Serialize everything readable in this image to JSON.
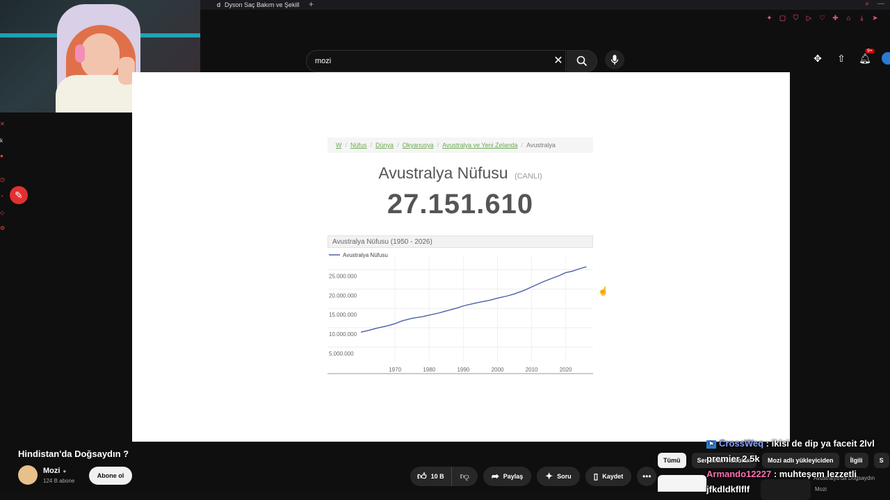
{
  "browser": {
    "tab_title": "Dyson Saç Bakım ve Şekill",
    "tab_favicon": "d",
    "new_tab_label": "+"
  },
  "search": {
    "query": "mozi"
  },
  "header": {
    "notif_count": "9+"
  },
  "page": {
    "breadcrumb": [
      "W",
      "Nüfus",
      "Dünya",
      "Okyanusya",
      "Avustralya ve Yeni Zelanda"
    ],
    "breadcrumb_current": "Avustralya",
    "title": "Avustralya Nüfusu",
    "live_label": "(CANLI)",
    "population": "27.151.610"
  },
  "chart_data": {
    "type": "line",
    "title": "Avustralya Nüfusu (1950 - 2026)",
    "legend": [
      "Avustralya Nüfusu"
    ],
    "legend_position": "top-left",
    "x_ticks": [
      "1970",
      "1980",
      "1990",
      "2000",
      "2010",
      "2020"
    ],
    "y_ticks": [
      "5.000.000",
      "10.000.000",
      "15.000.000",
      "20.000.000",
      "25.000.000"
    ],
    "xlim": [
      1960,
      2028
    ],
    "ylim": [
      3000000,
      28500000
    ],
    "grid": true,
    "series": [
      {
        "name": "Avustralya Nüfusu",
        "x": [
          1960,
          1962,
          1965,
          1968,
          1970,
          1972,
          1975,
          1978,
          1980,
          1983,
          1985,
          1988,
          1990,
          1993,
          1995,
          1998,
          2000,
          2003,
          2005,
          2008,
          2010,
          2013,
          2015,
          2018,
          2020,
          2022,
          2024,
          2026
        ],
        "y": [
          10300000,
          10700000,
          11400000,
          12000000,
          12500000,
          13200000,
          13900000,
          14300000,
          14700000,
          15300000,
          15800000,
          16500000,
          17100000,
          17700000,
          18100000,
          18600000,
          19100000,
          19700000,
          20200000,
          21200000,
          22000000,
          23200000,
          23900000,
          24900000,
          25700000,
          26100000,
          26700000,
          27200000
        ]
      }
    ],
    "line_color": "#4a5fa8"
  },
  "video": {
    "title": "Hindistan'da Doğsaydın ?",
    "channel": "Mozi",
    "subscribers": "124 B abone",
    "subscribe_label": "Abone ol",
    "likes": "10 B",
    "share_label": "Paylaş",
    "ask_label": "Soru",
    "save_label": "Kaydet"
  },
  "chips": [
    "Tümü",
    "Serisinin videoları",
    "Mozi adlı yükleyiciden",
    "İlgili",
    "S"
  ],
  "related": {
    "title": "Avustralya'da Doğsaydın",
    "channel": "Mozi"
  },
  "chat": [
    {
      "user": "CrossWeq",
      "text": "ikisi de dip ya faceit 2lvl premier 2.5k"
    },
    {
      "user": "Armando12227",
      "text": "muhteşem lezzetli jfkdldkflflf"
    }
  ],
  "colors": {
    "accent_red": "#cc0000",
    "chart_line": "#4a5fa8",
    "breadcrumb_link": "#6aa84f"
  }
}
